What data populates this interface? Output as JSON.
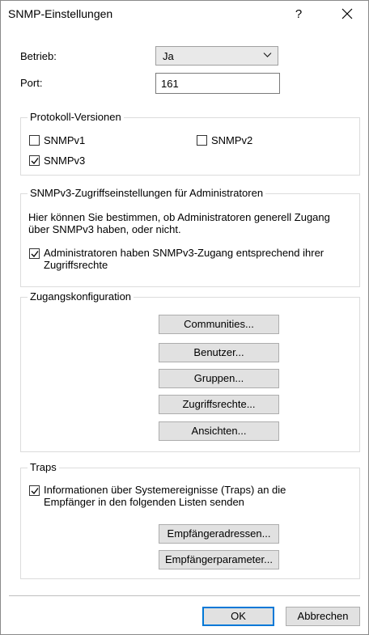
{
  "window": {
    "title": "SNMP-Einstellungen",
    "help_label": "?",
    "close_icon": "close-icon"
  },
  "general": {
    "betrieb_label": "Betrieb:",
    "betrieb_value": "Ja",
    "port_label": "Port:",
    "port_value": "161"
  },
  "protocol_versions": {
    "legend": "Protokoll-Versionen",
    "snmpv1": {
      "label": "SNMPv1",
      "checked": false
    },
    "snmpv2": {
      "label": "SNMPv2",
      "checked": false
    },
    "snmpv3": {
      "label": "SNMPv3",
      "checked": true
    }
  },
  "admin_access": {
    "legend": "SNMPv3-Zugriffseinstellungen für Administratoren",
    "description_line1": "Hier können Sie bestimmen, ob Administratoren generell Zugang",
    "description_line2": "über SNMPv3 haben, oder nicht.",
    "checkbox_line1": "Administratoren haben SNMPv3-Zugang entsprechend ihrer",
    "checkbox_line2": "Zugriffsrechte",
    "checked": true
  },
  "access_config": {
    "legend": "Zugangskonfiguration",
    "communities_button": "Communities...",
    "users_button": "Benutzer...",
    "groups_button": "Gruppen...",
    "access_rights_button": "Zugriffsrechte...",
    "views_button": "Ansichten..."
  },
  "traps": {
    "legend": "Traps",
    "checkbox_line1": "Informationen über Systemereignisse (Traps) an die",
    "checkbox_line2": "Empfänger in den folgenden Listen senden",
    "checked": true,
    "recipient_addresses_button": "Empfängeradressen...",
    "recipient_params_button": "Empfängerparameter..."
  },
  "footer": {
    "ok_button": "OK",
    "cancel_button": "Abbrechen"
  },
  "colors": {
    "button_bg": "#e1e1e1",
    "focus_border": "#0078d7",
    "group_border": "#dcdcdc"
  }
}
